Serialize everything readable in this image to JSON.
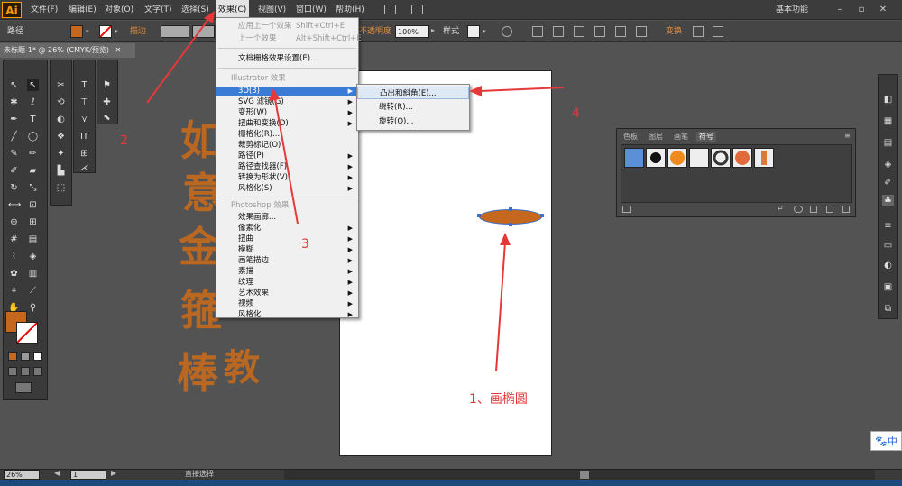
{
  "app": {
    "logo": "Ai"
  },
  "menubar": {
    "items": [
      "文件(F)",
      "编辑(E)",
      "对象(O)",
      "文字(T)",
      "选择(S)",
      "效果(C)",
      "视图(V)",
      "窗口(W)",
      "帮助(H)"
    ],
    "active": "效果(C)",
    "workspace": "基本功能"
  },
  "control_bar": {
    "object_type": "路径",
    "stroke_label": "描边",
    "opacity_label": "不透明度",
    "opacity_value": "100%",
    "style_label": "样式",
    "transform_label": "变换",
    "fill_color": "#c5671d"
  },
  "document": {
    "tab_title": "未标题-1* @ 26% (CMYK/预览)"
  },
  "effect_menu": {
    "apply_last": "应用上一个效果",
    "apply_last_shortcut": "Shift+Ctrl+E",
    "last_effect": "上一个效果",
    "last_effect_shortcut": "Alt+Shift+Ctrl+E",
    "raster_settings": "文档栅格效果设置(E)...",
    "illustrator_header": "Illustrator 效果",
    "illustrator_items": [
      "3D(3)",
      "SVG 滤镜(G)",
      "变形(W)",
      "扭曲和变换(D)",
      "栅格化(R)...",
      "裁剪标记(O)",
      "路径(P)",
      "路径查找器(F)",
      "转换为形状(V)",
      "风格化(S)"
    ],
    "photoshop_header": "Photoshop 效果",
    "photoshop_items": [
      "效果画廊...",
      "像素化",
      "扭曲",
      "模糊",
      "画笔描边",
      "素描",
      "纹理",
      "艺术效果",
      "视频",
      "风格化"
    ]
  },
  "submenu_3d": {
    "items": [
      "凸出和斜角(E)...",
      "绕转(R)...",
      "旋转(O)..."
    ]
  },
  "symbols_panel": {
    "tabs": [
      "色板",
      "图层",
      "画笔",
      "符号"
    ],
    "active_tab": "符号"
  },
  "status_bar": {
    "zoom": "26%",
    "page": "1",
    "tool": "直接选择"
  },
  "annotations": {
    "step1": "1、画椭圆",
    "step2": "2",
    "step3": "3",
    "step4": "4",
    "color": "#e53838"
  },
  "ime": {
    "label": "中"
  }
}
